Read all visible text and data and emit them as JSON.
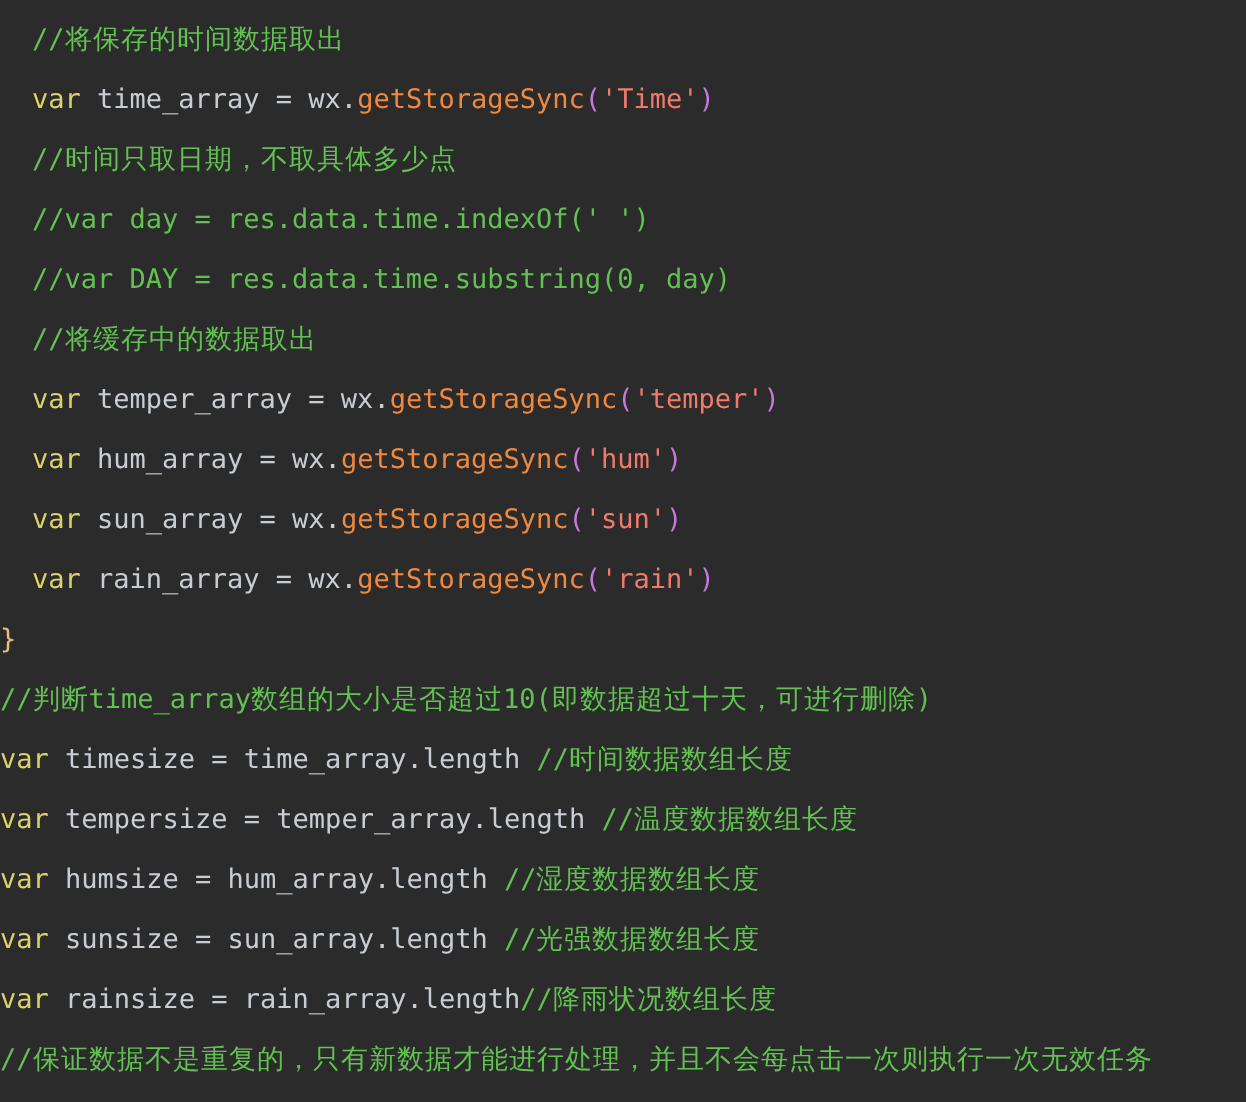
{
  "block": {
    "lines": [
      {
        "tokens": [
          {
            "kind": "comment",
            "text": "//将保存的时间数据取出"
          }
        ]
      },
      {
        "tokens": [
          {
            "kind": "keyword",
            "text": "var"
          },
          {
            "kind": "plain",
            "text": " time_array = wx."
          },
          {
            "kind": "function",
            "text": "getStorageSync"
          },
          {
            "kind": "paren",
            "text": "("
          },
          {
            "kind": "string",
            "text": "'Time'"
          },
          {
            "kind": "paren",
            "text": ")"
          }
        ]
      },
      {
        "tokens": [
          {
            "kind": "comment",
            "text": "//时间只取日期，不取具体多少点"
          }
        ]
      },
      {
        "tokens": [
          {
            "kind": "comment",
            "text": "//var day = res.data.time.indexOf(' ')"
          }
        ]
      },
      {
        "tokens": [
          {
            "kind": "comment",
            "text": "//var DAY = res.data.time.substring(0, day)"
          }
        ]
      },
      {
        "tokens": [
          {
            "kind": "comment",
            "text": "//将缓存中的数据取出"
          }
        ]
      },
      {
        "tokens": [
          {
            "kind": "keyword",
            "text": "var"
          },
          {
            "kind": "plain",
            "text": " temper_array = wx."
          },
          {
            "kind": "function",
            "text": "getStorageSync"
          },
          {
            "kind": "paren",
            "text": "("
          },
          {
            "kind": "string",
            "text": "'temper'"
          },
          {
            "kind": "paren",
            "text": ")"
          }
        ]
      },
      {
        "tokens": [
          {
            "kind": "keyword",
            "text": "var"
          },
          {
            "kind": "plain",
            "text": " hum_array = wx."
          },
          {
            "kind": "function",
            "text": "getStorageSync"
          },
          {
            "kind": "paren",
            "text": "("
          },
          {
            "kind": "string",
            "text": "'hum'"
          },
          {
            "kind": "paren",
            "text": ")"
          }
        ]
      },
      {
        "tokens": [
          {
            "kind": "keyword",
            "text": "var"
          },
          {
            "kind": "plain",
            "text": " sun_array = wx."
          },
          {
            "kind": "function",
            "text": "getStorageSync"
          },
          {
            "kind": "paren",
            "text": "("
          },
          {
            "kind": "string",
            "text": "'sun'"
          },
          {
            "kind": "paren",
            "text": ")"
          }
        ]
      },
      {
        "tokens": [
          {
            "kind": "keyword",
            "text": "var"
          },
          {
            "kind": "plain",
            "text": " rain_array = wx."
          },
          {
            "kind": "function",
            "text": "getStorageSync"
          },
          {
            "kind": "paren",
            "text": "("
          },
          {
            "kind": "string",
            "text": "'rain'"
          },
          {
            "kind": "paren",
            "text": ")"
          }
        ]
      }
    ],
    "closing": "}"
  },
  "lines": [
    {
      "tokens": [
        {
          "kind": "comment",
          "text": "//判断time_array数组的大小是否超过10(即数据超过十天，可进行删除)"
        }
      ]
    },
    {
      "tokens": [
        {
          "kind": "keyword",
          "text": "var"
        },
        {
          "kind": "plain",
          "text": " timesize = time_array.length "
        },
        {
          "kind": "comment",
          "text": "//时间数据数组长度"
        }
      ]
    },
    {
      "tokens": [
        {
          "kind": "keyword",
          "text": "var"
        },
        {
          "kind": "plain",
          "text": " tempersize = temper_array.length "
        },
        {
          "kind": "comment",
          "text": "//温度数据数组长度"
        }
      ]
    },
    {
      "tokens": [
        {
          "kind": "keyword",
          "text": "var"
        },
        {
          "kind": "plain",
          "text": " humsize = hum_array.length "
        },
        {
          "kind": "comment",
          "text": "//湿度数据数组长度"
        }
      ]
    },
    {
      "tokens": [
        {
          "kind": "keyword",
          "text": "var"
        },
        {
          "kind": "plain",
          "text": " sunsize = sun_array.length "
        },
        {
          "kind": "comment",
          "text": "//光强数据数组长度"
        }
      ]
    },
    {
      "tokens": [
        {
          "kind": "keyword",
          "text": "var"
        },
        {
          "kind": "plain",
          "text": " rainsize = rain_array.length"
        },
        {
          "kind": "comment",
          "text": "//降雨状况数组长度"
        }
      ]
    },
    {
      "tokens": [
        {
          "kind": "comment",
          "text": "//保证数据不是重复的，只有新数据才能进行处理，并且不会每点击一次则执行一次无效任务"
        }
      ]
    }
  ]
}
